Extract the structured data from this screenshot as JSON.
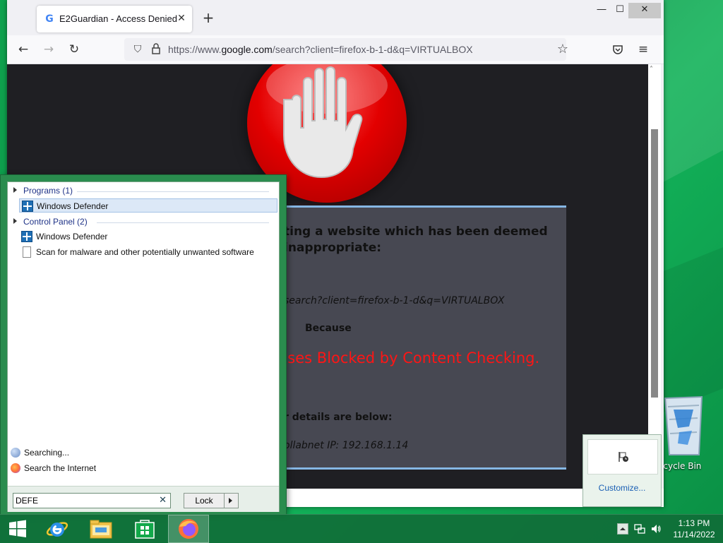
{
  "browser": {
    "tab_title": "E2Guardian - Access Denied",
    "url_prefix": "https://www.",
    "url_domain": "google.com",
    "url_rest": "/search?client=firefox-b-1-d&q=VIRTUALBOX"
  },
  "block_page": {
    "heading_line1": "ting a website which has been deemed",
    "heading_line2": "inappropriate:",
    "blocked_url": "search?client=firefox-b-1-d&q=VIRTUALBOX",
    "because_label": "Because",
    "reason": "uses  Blocked by Content Checking.",
    "details_heading": "r details are below:",
    "details_line": "ollabnet   IP: 192.168.1.14"
  },
  "start_menu": {
    "groups": [
      {
        "title": "Programs (1)",
        "items": [
          {
            "label": "Windows Defender",
            "icon": "windows-defender-icon",
            "selected": true
          }
        ]
      },
      {
        "title": "Control Panel (2)",
        "items": [
          {
            "label": "Windows Defender",
            "icon": "windows-defender-icon",
            "selected": false
          },
          {
            "label": "Scan for malware and other potentially unwanted software",
            "icon": "document-icon",
            "selected": false
          }
        ]
      }
    ],
    "searching_label": "Searching...",
    "search_internet_label": "Search the Internet",
    "search_value": "DEFE",
    "lock_label": "Lock"
  },
  "tray_flyout": {
    "customize_label": "Customize..."
  },
  "desktop": {
    "recycle_bin_label": "ecycle Bin"
  },
  "taskbar": {
    "time": "1:13 PM",
    "date": "11/14/2022",
    "pinned": [
      "windows-start-icon",
      "internet-explorer-icon",
      "file-explorer-icon",
      "store-icon",
      "firefox-icon"
    ]
  },
  "colors": {
    "desktop_green": "#0fa24e",
    "block_reason_red": "#ff1515",
    "block_box": "#474852",
    "block_box_border": "#86b7e4"
  }
}
